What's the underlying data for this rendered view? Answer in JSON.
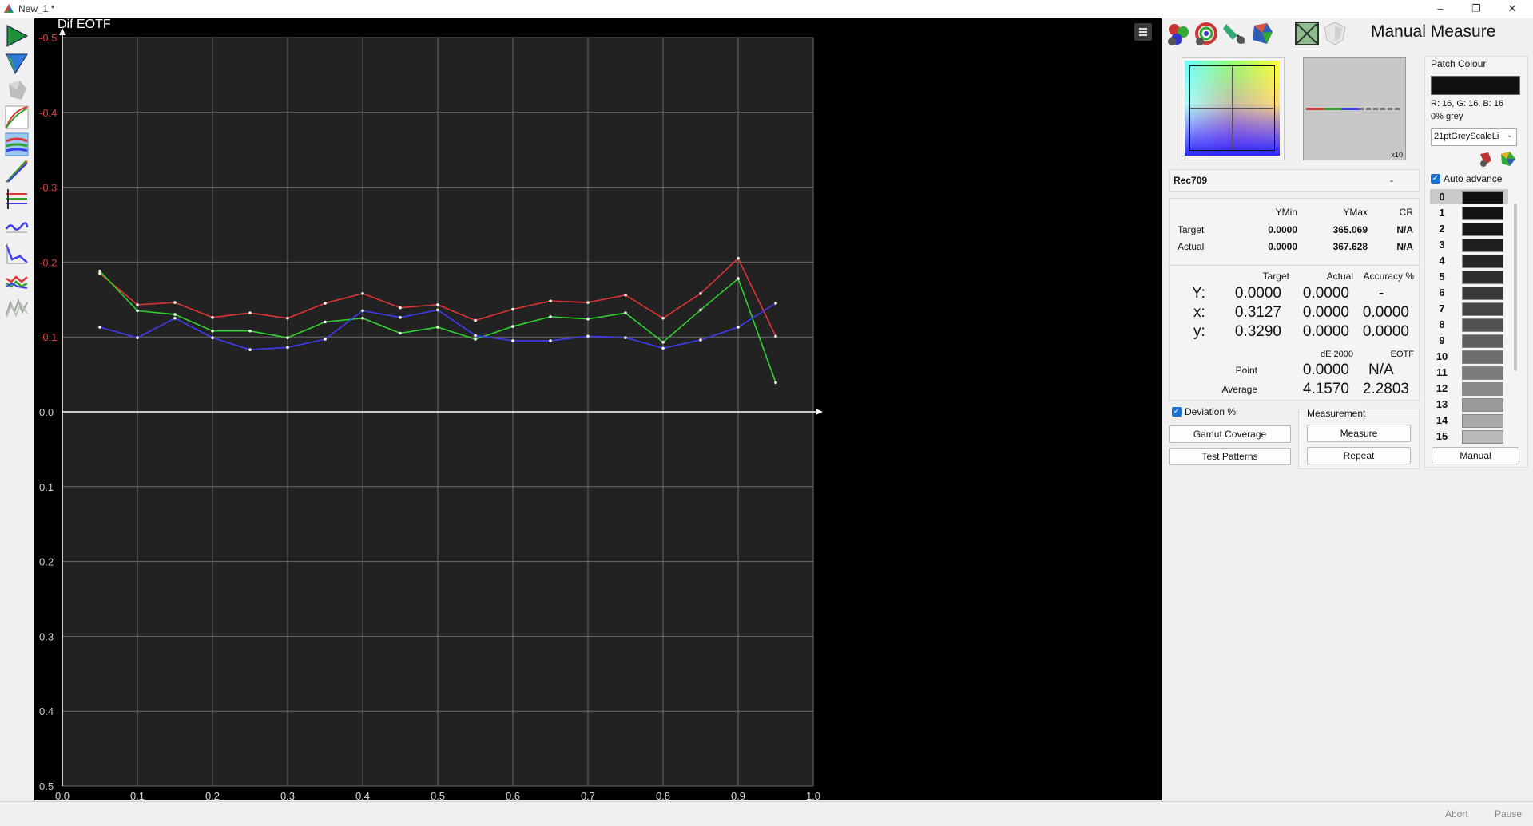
{
  "window": {
    "title": "New_1 *",
    "minimize": "–",
    "restore": "❐",
    "close": "✕"
  },
  "chart": {
    "title": "Dif EOTF",
    "colors": {
      "red": "#e03434",
      "green": "#2fd12f",
      "blue": "#3c3cf0",
      "grid": "#6a6a6a",
      "axis": "#ffffff",
      "neg_label": "#e03a3a",
      "pos_label": "#cfcfcf",
      "bg": "#222222"
    }
  },
  "chart_data": {
    "type": "line",
    "title": "Dif EOTF",
    "xlabel": "",
    "ylabel": "",
    "xlim": [
      0,
      1
    ],
    "ylim": [
      -0.5,
      0.5
    ],
    "y_inverted": true,
    "grid": true,
    "x_ticks": [
      "0.0",
      "0.1",
      "0.2",
      "0.3",
      "0.4",
      "0.5",
      "0.6",
      "0.7",
      "0.8",
      "0.9",
      "1.0"
    ],
    "y_ticks": [
      "-0.5",
      "-0.4",
      "-0.3",
      "-0.2",
      "-0.1",
      "0.0",
      "0.1",
      "0.2",
      "0.3",
      "0.4",
      "0.5"
    ],
    "x": [
      0.05,
      0.1,
      0.15,
      0.2,
      0.25,
      0.3,
      0.35,
      0.4,
      0.45,
      0.5,
      0.55,
      0.6,
      0.65,
      0.7,
      0.75,
      0.8,
      0.85,
      0.9,
      0.95
    ],
    "series": [
      {
        "color": "red",
        "values": [
          -0.185,
          -0.143,
          -0.146,
          -0.126,
          -0.132,
          -0.125,
          -0.145,
          -0.158,
          -0.139,
          -0.143,
          -0.122,
          -0.137,
          -0.148,
          -0.146,
          -0.156,
          -0.125,
          -0.158,
          -0.205,
          -0.101
        ]
      },
      {
        "color": "green",
        "values": [
          -0.188,
          -0.135,
          -0.13,
          -0.108,
          -0.108,
          -0.099,
          -0.12,
          -0.125,
          -0.105,
          -0.113,
          -0.097,
          -0.114,
          -0.127,
          -0.124,
          -0.132,
          -0.093,
          -0.136,
          -0.178,
          -0.039
        ]
      },
      {
        "color": "blue",
        "values": [
          -0.113,
          -0.099,
          -0.125,
          -0.099,
          -0.083,
          -0.086,
          -0.097,
          -0.135,
          -0.126,
          -0.136,
          -0.102,
          -0.095,
          -0.095,
          -0.101,
          -0.099,
          -0.085,
          -0.096,
          -0.113,
          -0.145
        ]
      }
    ]
  },
  "panel": {
    "title": "Manual Measure",
    "toolbar_icons": [
      "chromaticity-swatches-icon",
      "colour-wheel-icon",
      "meter-probe-icon",
      "gamut-solid-icon",
      "crossed-box-icon",
      "shield-gamut-icon"
    ],
    "gamut_preview": {
      "zoom": "x10"
    },
    "colorspace": {
      "name": "Rec709",
      "dash": "-"
    },
    "summary": {
      "headers": [
        "YMin",
        "YMax",
        "CR"
      ],
      "rows": [
        {
          "label": "Target",
          "ymin": "0.0000",
          "ymax": "365.069",
          "cr": "N/A"
        },
        {
          "label": "Actual",
          "ymin": "0.0000",
          "ymax": "367.628",
          "cr": "N/A"
        }
      ]
    },
    "measure": {
      "headers": [
        "Target",
        "Actual",
        "Accuracy %"
      ],
      "rows": [
        {
          "label": "Y:",
          "target": "0.0000",
          "actual": "0.0000",
          "acc": "-"
        },
        {
          "label": "x:",
          "target": "0.3127",
          "actual": "0.0000",
          "acc": "0.0000"
        },
        {
          "label": "y:",
          "target": "0.3290",
          "actual": "0.0000",
          "acc": "0.0000"
        }
      ],
      "de_header": "dE 2000",
      "eotf_header": "EOTF",
      "point_label": "Point",
      "point_de": "0.0000",
      "point_eotf": "N/A",
      "avg_label": "Average",
      "avg_de": "4.1570",
      "avg_eotf": "2.2803"
    },
    "deviation_label": "Deviation %",
    "measurement_group": "Measurement",
    "buttons": {
      "gamut": "Gamut Coverage",
      "test": "Test Patterns",
      "measure": "Measure",
      "repeat": "Repeat",
      "manual": "Manual"
    },
    "patch": {
      "heading": "Patch Colour",
      "rgb": "R: 16, G: 16, B: 16",
      "desc": "0% grey",
      "preset": "21ptGreyScaleLi",
      "auto_label": "Auto advance",
      "items": [
        {
          "n": "0",
          "c": "#101010"
        },
        {
          "n": "1",
          "c": "#131313"
        },
        {
          "n": "2",
          "c": "#181818"
        },
        {
          "n": "3",
          "c": "#1e1e1e"
        },
        {
          "n": "4",
          "c": "#252525"
        },
        {
          "n": "5",
          "c": "#2d2d2d"
        },
        {
          "n": "6",
          "c": "#383838"
        },
        {
          "n": "7",
          "c": "#444444"
        },
        {
          "n": "8",
          "c": "#515151"
        },
        {
          "n": "9",
          "c": "#5e5e5e"
        },
        {
          "n": "10",
          "c": "#6c6c6c"
        },
        {
          "n": "11",
          "c": "#7b7b7b"
        },
        {
          "n": "12",
          "c": "#8a8a8a"
        },
        {
          "n": "13",
          "c": "#999999"
        },
        {
          "n": "14",
          "c": "#a9a9a9"
        },
        {
          "n": "15",
          "c": "#b9b9b9"
        }
      ]
    }
  },
  "status": {
    "abort": "Abort",
    "pause": "Pause"
  }
}
